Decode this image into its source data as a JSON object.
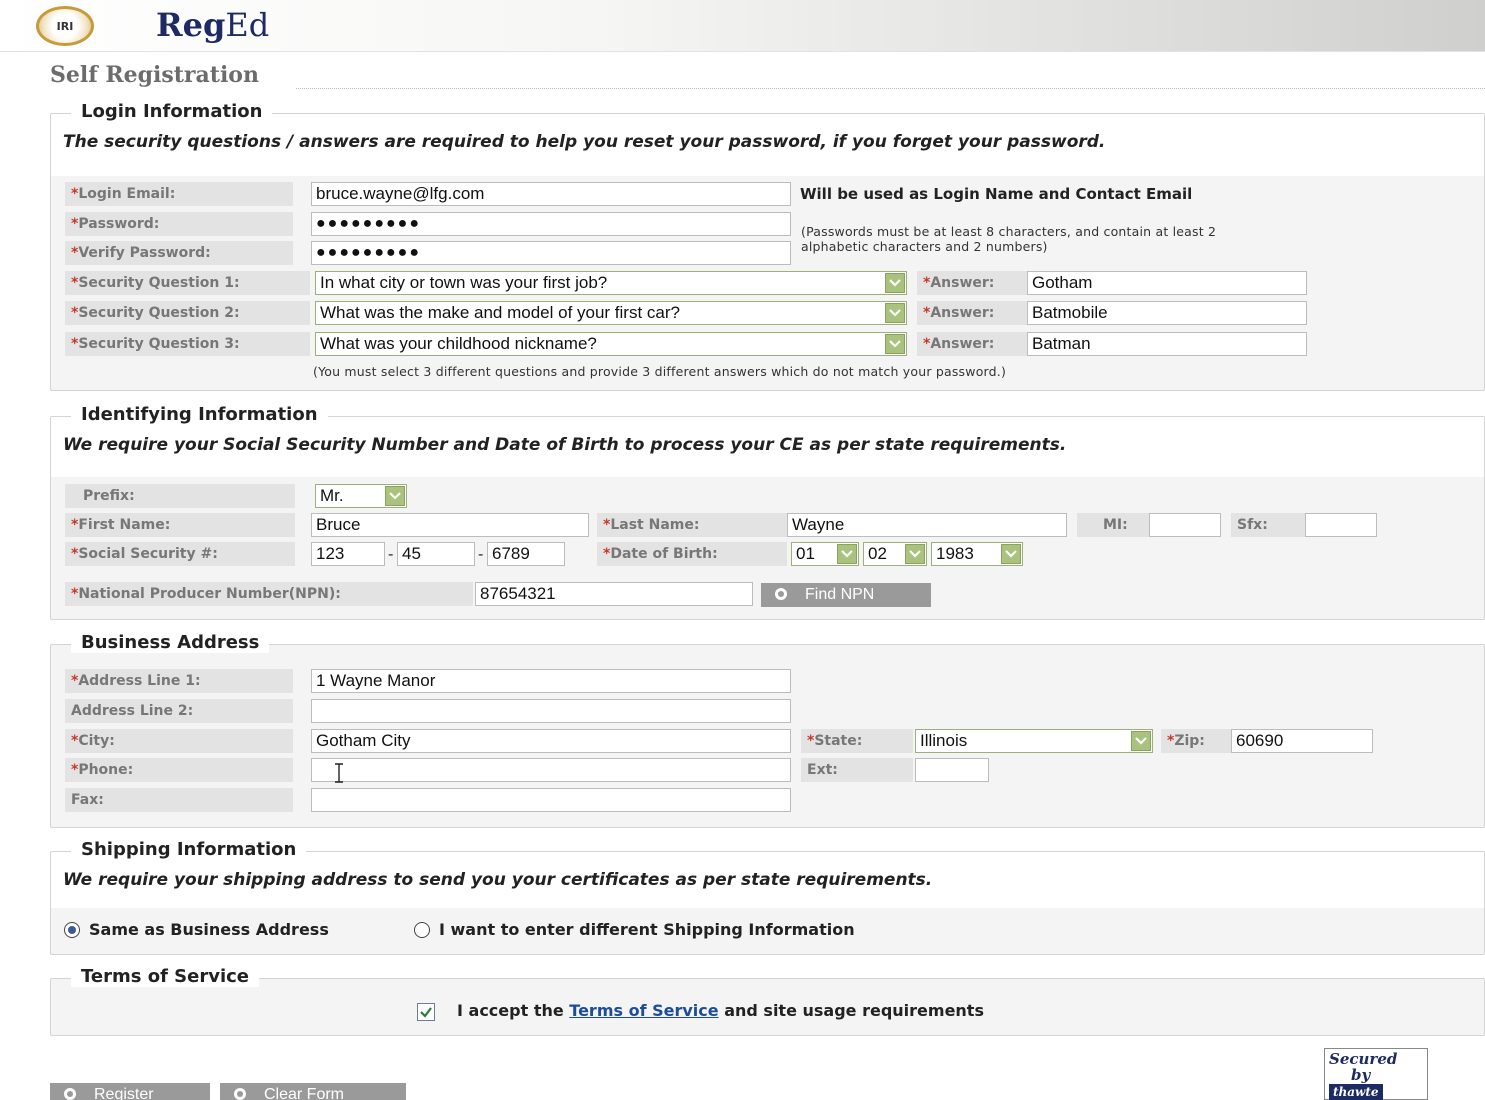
{
  "header": {
    "logo_text": "IRI",
    "brand_bold": "Reg",
    "brand_rest": "Ed"
  },
  "page_title": "Self Registration",
  "login": {
    "legend": "Login Information",
    "note": "The security questions / answers are required to help you reset your password, if you forget your password.",
    "email_label": "Login Email:",
    "email_value": "bruce.wayne@lfg.com",
    "email_hint": "Will be used as Login Name and Contact Email",
    "password_label": "Password:",
    "password_value": "●●●●●●●●●",
    "verify_label": "Verify Password:",
    "verify_value": "●●●●●●●●●",
    "password_hint_1": "(Passwords must be at least 8 characters, and contain at least 2",
    "password_hint_2": "alphabetic characters and 2 numbers)",
    "q1_label": "Security Question 1:",
    "q1_value": "In what city or town was your first job?",
    "q2_label": "Security Question 2:",
    "q2_value": "What was the make and model of your first car?",
    "q3_label": "Security Question 3:",
    "q3_value": "What was your childhood nickname?",
    "answer_label": "Answer:",
    "a1_value": "Gotham",
    "a2_value": "Batmobile",
    "a3_value": "Batman",
    "questions_hint": "(You must select 3 different questions and provide 3 different answers which do not match your password.)"
  },
  "identifying": {
    "legend": "Identifying Information",
    "note": "We require your Social Security Number and Date of Birth to process your CE as per state requirements.",
    "prefix_label": "Prefix:",
    "prefix_value": "Mr.",
    "first_label": "First Name:",
    "first_value": "Bruce",
    "last_label": "Last Name:",
    "last_value": "Wayne",
    "mi_label": "MI:",
    "mi_value": "",
    "sfx_label": "Sfx:",
    "sfx_value": "",
    "ssn_label": "Social Security #:",
    "ssn_1": "123",
    "ssn_2": "45",
    "ssn_3": "6789",
    "dash": "-",
    "dob_label": "Date of Birth:",
    "dob_month": "01",
    "dob_day": "02",
    "dob_year": "1983",
    "npn_label": "National Producer Number(NPN):",
    "npn_value": "87654321",
    "find_npn": "Find NPN"
  },
  "business": {
    "legend": "Business Address",
    "addr1_label": "Address Line 1:",
    "addr1_value": "1 Wayne Manor",
    "addr2_label": "Address Line 2:",
    "addr2_value": "",
    "city_label": "City:",
    "city_value": "Gotham City",
    "state_label": "State:",
    "state_value": "Illinois",
    "zip_label": "Zip:",
    "zip_value": "60690",
    "phone_label": "Phone:",
    "phone_value": "",
    "ext_label": "Ext:",
    "ext_value": "",
    "fax_label": "Fax:",
    "fax_value": ""
  },
  "shipping": {
    "legend": "Shipping Information",
    "note": "We require your shipping address to send you your certificates as per state requirements.",
    "option_same": "Same as Business Address",
    "option_different": "I want to enter different Shipping Information"
  },
  "terms": {
    "legend": "Terms of Service",
    "accept_prefix": "I accept the",
    "accept_link": "Terms of Service",
    "accept_suffix": "and site usage requirements"
  },
  "buttons": {
    "register": "Register",
    "clear": "Clear Form"
  },
  "seal": {
    "line1": "Secured",
    "line2": "by",
    "line3": "thawte"
  },
  "required_mark": "*"
}
